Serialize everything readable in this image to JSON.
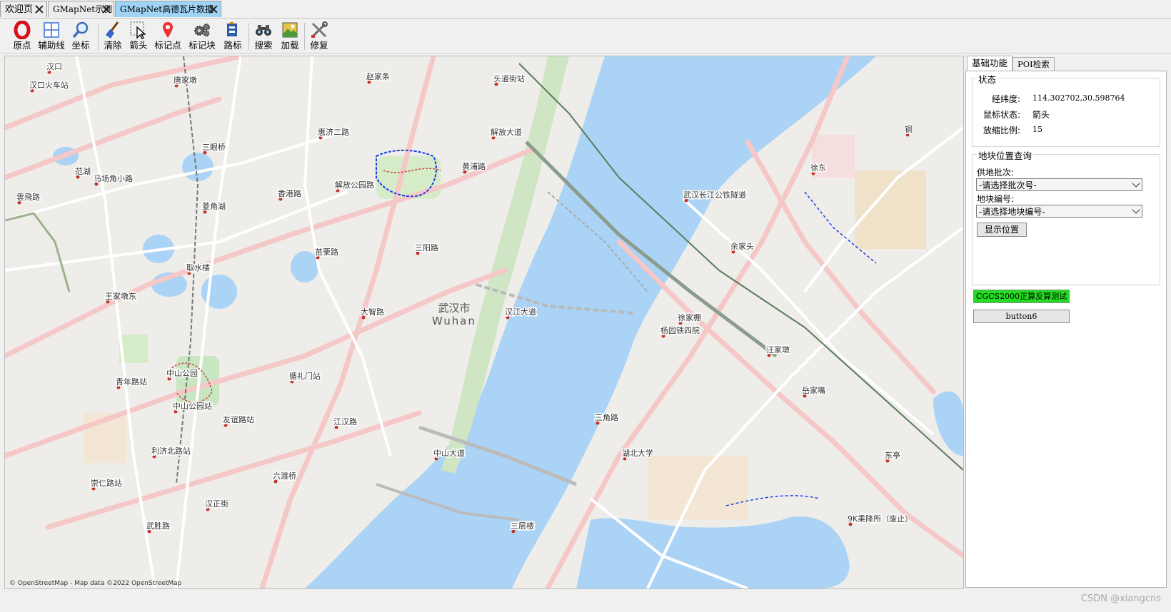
{
  "tabs": [
    {
      "label": "欢迎页"
    },
    {
      "label": "GMapNet示例"
    },
    {
      "label": "GMapNet高德瓦片数据"
    }
  ],
  "toolbar": [
    {
      "label": "原点",
      "icon": "opera-o-icon"
    },
    {
      "label": "辅助线",
      "icon": "grid-icon"
    },
    {
      "label": "坐标",
      "icon": "magnifier-icon"
    },
    {
      "label": "清除",
      "icon": "broom-icon"
    },
    {
      "label": "箭头",
      "icon": "cursor-icon"
    },
    {
      "label": "标记点",
      "icon": "pin-icon"
    },
    {
      "label": "标记块",
      "icon": "gears-icon"
    },
    {
      "label": "路标",
      "icon": "signpost-icon"
    },
    {
      "label": "搜索",
      "icon": "binoculars-icon"
    },
    {
      "label": "加载",
      "icon": "load-image-icon"
    },
    {
      "label": "修复",
      "icon": "tools-icon"
    }
  ],
  "map": {
    "attribution": "© OpenStreetMap - Map data ©2022 OpenStreetMap",
    "city": {
      "zh": "武汉市",
      "en": "Wuhan"
    },
    "places": [
      "汉口",
      "汉口火车站",
      "唐家墩",
      "赵家条",
      "头道街站",
      "三眼桥",
      "惠济二路",
      "黄浦路",
      "范湖",
      "马场角小路",
      "香港路",
      "雲飛路",
      "菱角湖",
      "解放公园路",
      "苗栗路",
      "三阳路",
      "取水楼",
      "王家墩东",
      "大智路",
      "循礼门站",
      "中山公园",
      "青年路站",
      "中山公园站",
      "友谊路站",
      "江汉路",
      "利济北路站",
      "六渡桥",
      "崇仁路站",
      "汉正街",
      "武胜路",
      "三层楼",
      "三角路",
      "湖北大学",
      "徐家棚",
      "杨园铁四院",
      "余家头",
      "徐东",
      "汪家墩",
      "岳家嘴",
      "东亭",
      "9K乘降所（废止）",
      "武汉长江公铁隧道",
      "汉江大道",
      "解放大道",
      "中山大道",
      "钢"
    ]
  },
  "panel": {
    "tabs": [
      "基础功能",
      "POI检索"
    ],
    "status": {
      "title": "状态",
      "lnglat_label": "经纬度:",
      "lnglat_value": "114.302702,30.598764",
      "mouse_label": "鼠标状态:",
      "mouse_value": "箭头",
      "zoom_label": "放缩比例:",
      "zoom_value": "15"
    },
    "query": {
      "title": "地块位置查询",
      "batch_label": "供地批次:",
      "batch_value": "-请选择批次号-",
      "block_label": "地块编号:",
      "block_value": "-请选择地块编号-",
      "show_button": "显示位置"
    },
    "cgcs_button": "CGCS2000正算反算测试",
    "button6": "button6"
  },
  "watermark": "CSDN @xiangcns",
  "colors": {
    "active_tab": "#9fd4f5",
    "cgcs_button": "#22dd22",
    "water": "#aad3f5",
    "land": "#eeede9"
  }
}
